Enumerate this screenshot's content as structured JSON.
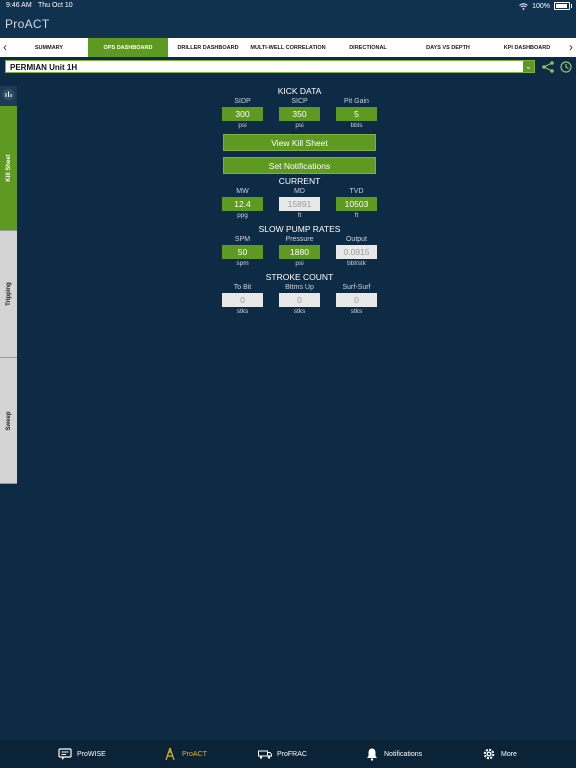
{
  "status_bar": {
    "time": "9:46 AM",
    "date": "Thu Oct 10",
    "battery": "100%"
  },
  "app": {
    "title": "ProACT"
  },
  "tabs": [
    {
      "label": "SUMMARY"
    },
    {
      "label": "OPS DASHBOARD"
    },
    {
      "label": "DRILLER DASHBOARD"
    },
    {
      "label": "MULTI-WELL CORRELATION"
    },
    {
      "label": "DIRECTIONAL"
    },
    {
      "label": "DAYS VS DEPTH"
    },
    {
      "label": "KPI DASHBOARD"
    }
  ],
  "well": {
    "name": "PERMIAN Unit 1H"
  },
  "side_tabs": [
    {
      "label": "Kill Sheet"
    },
    {
      "label": "Tripping"
    },
    {
      "label": "Sweep"
    }
  ],
  "kick_data": {
    "title": "KICK DATA",
    "fields": [
      {
        "label": "SIDP",
        "value": "300",
        "unit": "psi"
      },
      {
        "label": "SICP",
        "value": "350",
        "unit": "psi"
      },
      {
        "label": "Pit Gain",
        "value": "5",
        "unit": "bbls"
      }
    ]
  },
  "buttons": {
    "view_kill_sheet": "View Kill Sheet",
    "set_notifications": "Set Notifications"
  },
  "current": {
    "title": "CURRENT",
    "fields": [
      {
        "label": "MW",
        "value": "12.4",
        "unit": "ppg"
      },
      {
        "label": "MD",
        "value": "15891",
        "unit": "ft"
      },
      {
        "label": "TVD",
        "value": "10503",
        "unit": "ft"
      }
    ]
  },
  "slow_pump_rates": {
    "title": "SLOW PUMP RATES",
    "fields": [
      {
        "label": "SPM",
        "value": "50",
        "unit": "spm"
      },
      {
        "label": "Pressure",
        "value": "1880",
        "unit": "psi"
      },
      {
        "label": "Output",
        "value": "0.0915",
        "unit": "bbl/stk"
      }
    ]
  },
  "stroke_count": {
    "title": "STROKE COUNT",
    "fields": [
      {
        "label": "To Bit",
        "value": "0",
        "unit": "stks"
      },
      {
        "label": "Bttms Up",
        "value": "0",
        "unit": "stks"
      },
      {
        "label": "Surf-Surf",
        "value": "0",
        "unit": "stks"
      }
    ]
  },
  "bottom_nav": [
    {
      "label": "ProWISE"
    },
    {
      "label": "ProACT"
    },
    {
      "label": "ProFRAC"
    },
    {
      "label": "Notifications"
    },
    {
      "label": "More"
    }
  ],
  "colors": {
    "background": "#0e2b45",
    "accent": "#5e9a21",
    "active_nav": "#e2b417"
  }
}
